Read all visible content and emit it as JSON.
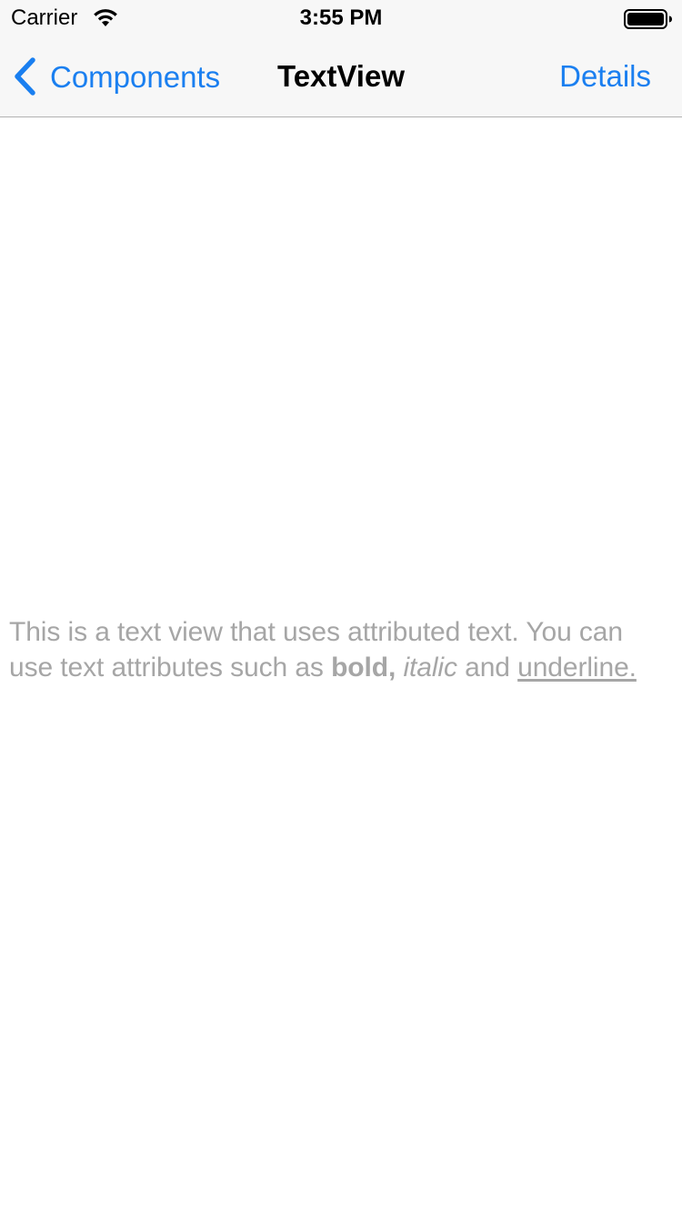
{
  "status_bar": {
    "carrier": "Carrier",
    "time": "3:55 PM",
    "wifi_icon": "wifi-icon",
    "battery_icon": "battery-full-icon"
  },
  "nav_bar": {
    "back_label": "Components",
    "back_icon": "chevron-left-icon",
    "title": "TextView",
    "right_button_label": "Details",
    "tint_color": "#1a7ff0"
  },
  "text_view": {
    "segments": {
      "intro": "This is a text view that uses attributed text. You can use text attributes such as ",
      "bold": "bold,",
      "space_after_bold": " ",
      "italic": "italic",
      "and": " and ",
      "underline": "underline."
    },
    "text_color": "#a6a6a6"
  }
}
